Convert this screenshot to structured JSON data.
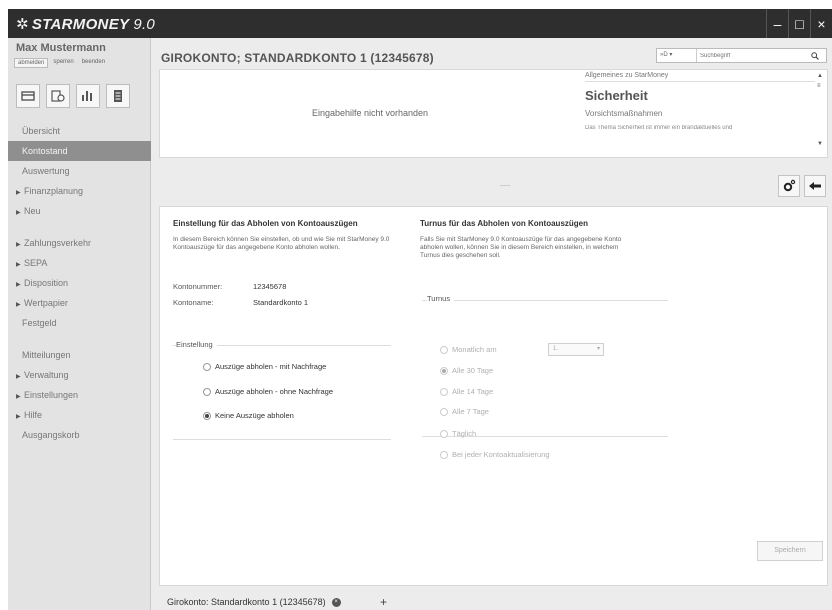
{
  "app": {
    "brand": "STARMONEY",
    "version": "9.0",
    "window_buttons": [
      "–",
      "□",
      "×"
    ]
  },
  "user": {
    "name": "Max Mustermann",
    "links": [
      "abmelden",
      "sperren",
      "beenden"
    ]
  },
  "sidebar": {
    "icons": [
      "accounts-icon",
      "transfer-icon",
      "chart-icon",
      "document-icon"
    ],
    "items": [
      {
        "label": "Übersicht",
        "arrow": false,
        "active": false
      },
      {
        "label": "Kontostand",
        "arrow": false,
        "active": true
      },
      {
        "label": "Auswertung",
        "arrow": false,
        "active": false
      },
      {
        "label": "Finanzplanung",
        "arrow": true,
        "active": false
      },
      {
        "label": "Neu",
        "arrow": true,
        "active": false
      },
      {
        "label": "Zahlungsverkehr",
        "arrow": true,
        "active": false
      },
      {
        "label": "SEPA",
        "arrow": true,
        "active": false
      },
      {
        "label": "Disposition",
        "arrow": true,
        "active": false
      },
      {
        "label": "Wertpapier",
        "arrow": true,
        "active": false
      },
      {
        "label": "Festgeld",
        "arrow": false,
        "active": false
      },
      {
        "label": "Mitteilungen",
        "arrow": false,
        "active": false
      },
      {
        "label": "Verwaltung",
        "arrow": true,
        "active": false
      },
      {
        "label": "Einstellungen",
        "arrow": true,
        "active": false
      },
      {
        "label": "Hilfe",
        "arrow": true,
        "active": false
      },
      {
        "label": "Ausgangskorb",
        "arrow": false,
        "active": false
      }
    ]
  },
  "header": {
    "title": "GIROKONTO; STANDARDKONTO 1 (12345678)",
    "search_scope": "»D ▾",
    "search_placeholder": "Suchbegriff"
  },
  "help_panel": {
    "no_help": "Eingabehilfe nicht vorhanden",
    "section": "Allgemeines zu StarMoney",
    "topic": "Sicherheit",
    "subtopic": "Vorsichtsmaßnahmen",
    "text": "Das Thema Sicherheit ist immer ein brandaktuelles und"
  },
  "left_section": {
    "title": "Einstellung für das Abholen von Kontoauszügen",
    "desc": "In diesem Bereich können Sie einstellen, ob und wie Sie mit StarMoney 9.0 Kontoauszüge für das angegebene Konto abholen wollen.",
    "kontonummer_label": "Kontonummer:",
    "kontonummer_value": "12345678",
    "kontoname_label": "Kontoname:",
    "kontoname_value": "Standardkonto 1",
    "einstellung_legend": "Einstellung",
    "options": [
      {
        "label": "Auszüge abholen - mit Nachfrage",
        "checked": false
      },
      {
        "label": "Auszüge abholen - ohne Nachfrage",
        "checked": false
      },
      {
        "label": "Keine Auszüge abholen",
        "checked": true
      }
    ]
  },
  "right_section": {
    "title": "Turnus für das Abholen von Kontoauszügen",
    "desc": "Falls Sie mit StarMoney 9.0 Kontoauszüge für das angegebene Konto abholen wollen, können Sie in diesem Bereich einstellen, in welchem Turnus dies geschehen soll.",
    "turnus_legend": "Turnus",
    "month_select_value": "1.",
    "options": [
      {
        "label": "Monatlich am",
        "checked": false
      },
      {
        "label": "Alle 30 Tage",
        "checked": true
      },
      {
        "label": "Alle 14 Tage",
        "checked": false
      },
      {
        "label": "Alle 7 Tage",
        "checked": false
      },
      {
        "label": "Täglich",
        "checked": false
      },
      {
        "label": "Bei jeder Kontoaktualisierung",
        "checked": false
      }
    ]
  },
  "actions": {
    "save": "Speichern"
  },
  "tabs": {
    "active": "Girokonto: Standardkonto 1 (12345678)",
    "close": "×",
    "add": "+"
  }
}
